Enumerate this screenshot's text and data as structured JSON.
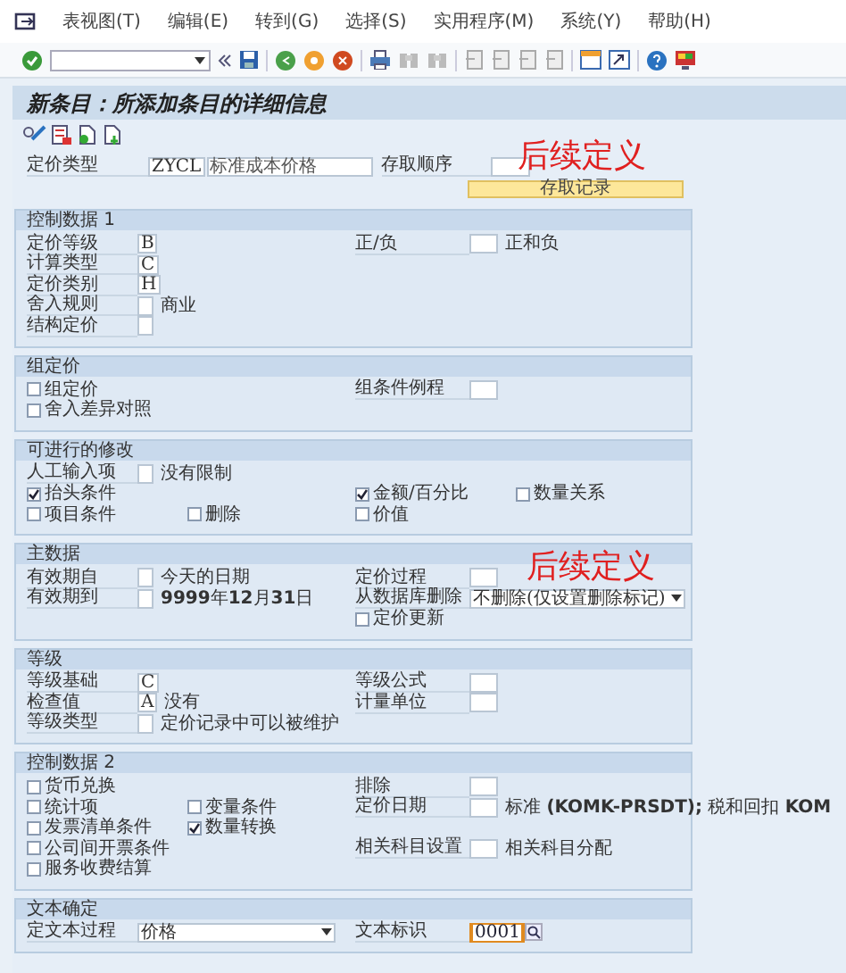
{
  "menu": [
    "表视图(T)",
    "编辑(E)",
    "转到(G)",
    "选择(S)",
    "实用程序(M)",
    "系统(Y)",
    "帮助(H)"
  ],
  "title": "新条目：所添加条目的详细信息",
  "header": {
    "pricing_type": {
      "label": "定价类型",
      "value": "ZYCL",
      "description": "标准成本价格"
    },
    "access_sequence": {
      "label": "存取顺序"
    },
    "annotation": "后续定义",
    "button": "存取记录"
  },
  "sections": [
    {
      "title": "控制数据 1",
      "rows": [
        {
          "left": [
            {
              "kind": "field",
              "label": "定价等级",
              "value": "B"
            }
          ],
          "right": [
            {
              "kind": "field",
              "label": "正/负",
              "text": "正和负"
            }
          ]
        },
        {
          "left": [
            {
              "kind": "field",
              "label": "计算类型",
              "value": "C"
            }
          ]
        },
        {
          "left": [
            {
              "kind": "field",
              "label": "定价类别",
              "value": "H"
            }
          ]
        },
        {
          "left": [
            {
              "kind": "field",
              "label": "舍入规则",
              "text": "商业"
            }
          ]
        },
        {
          "left": [
            {
              "kind": "field",
              "label": "结构定价"
            }
          ]
        }
      ]
    },
    {
      "title": "组定价",
      "rows": [
        {
          "left": [
            {
              "kind": "checkbox",
              "label": "组定价",
              "checked": false
            }
          ],
          "right": [
            {
              "kind": "field",
              "label": "组条件例程"
            }
          ]
        },
        {
          "left": [
            {
              "kind": "checkbox",
              "label": "舍入差异对照",
              "checked": false
            }
          ]
        }
      ]
    },
    {
      "title": "可进行的修改",
      "rows": [
        {
          "left": [
            {
              "kind": "field",
              "label": "人工输入项",
              "text": "没有限制"
            }
          ]
        },
        {
          "left": [
            {
              "kind": "checkbox",
              "label": "抬头条件",
              "checked": true
            }
          ],
          "right": [
            {
              "kind": "checkbox",
              "label": "金额/百分比",
              "checked": true
            },
            {
              "kind": "checkbox",
              "label": "数量关系",
              "checked": false
            }
          ]
        },
        {
          "left": [
            {
              "kind": "checkbox",
              "label": "项目条件",
              "checked": false
            },
            {
              "kind": "checkbox",
              "label": "删除",
              "checked": false
            }
          ],
          "right": [
            {
              "kind": "checkbox",
              "label": "价值",
              "checked": false
            }
          ]
        }
      ]
    },
    {
      "title": "主数据",
      "rows": [
        {
          "left": [
            {
              "kind": "field",
              "label": "有效期自",
              "text": "今天的日期"
            }
          ],
          "right": [
            {
              "kind": "field",
              "label": "定价过程",
              "annotation": "后续定义"
            }
          ]
        },
        {
          "left": [
            {
              "kind": "field",
              "label": "有效期到",
              "text": "**9999**年**12**月**31**日"
            }
          ],
          "right": [
            {
              "kind": "dropdown",
              "label": "从数据库删除",
              "value": "不删除(仅设置删除标记)"
            }
          ]
        },
        {
          "right": [
            {
              "kind": "checkbox",
              "label": "定价更新",
              "checked": false
            }
          ]
        }
      ]
    },
    {
      "title": "等级",
      "rows": [
        {
          "left": [
            {
              "kind": "field",
              "label": "等级基础",
              "value": "C"
            }
          ],
          "right": [
            {
              "kind": "field",
              "label": "等级公式"
            }
          ]
        },
        {
          "left": [
            {
              "kind": "field",
              "label": "检查值",
              "value": "A",
              "text": "没有"
            }
          ],
          "right": [
            {
              "kind": "field",
              "label": "计量单位"
            }
          ]
        },
        {
          "left": [
            {
              "kind": "field",
              "label": "等级类型",
              "text": "定价记录中可以被维护"
            }
          ]
        }
      ]
    },
    {
      "title": "控制数据 2",
      "rows": [
        {
          "left": [
            {
              "kind": "checkbox",
              "label": "货币兑换",
              "checked": false
            }
          ],
          "right": [
            {
              "kind": "field",
              "label": "排除"
            }
          ]
        },
        {
          "left": [
            {
              "kind": "checkbox",
              "label": "统计项",
              "checked": false
            },
            {
              "kind": "checkbox",
              "label": "变量条件",
              "checked": false
            }
          ],
          "right": [
            {
              "kind": "field",
              "label": "定价日期",
              "text": "标准 **(KOMK-PRSDT);** 税和回扣 **KOM**"
            }
          ]
        },
        {
          "left": [
            {
              "kind": "checkbox",
              "label": "发票清单条件",
              "checked": false
            },
            {
              "kind": "checkbox",
              "label": "数量转换",
              "checked": true
            }
          ]
        },
        {
          "left": [
            {
              "kind": "checkbox",
              "label": "公司间开票条件",
              "checked": false
            }
          ],
          "right": [
            {
              "kind": "field",
              "label": "相关科目设置",
              "text": "相关科目分配"
            }
          ]
        },
        {
          "left": [
            {
              "kind": "checkbox",
              "label": "服务收费结算",
              "checked": false
            }
          ]
        }
      ]
    },
    {
      "title": "文本确定",
      "rows": [
        {
          "left": [
            {
              "kind": "dropdown",
              "label": "定文本过程",
              "value": "价格"
            }
          ],
          "right": [
            {
              "kind": "lookup",
              "label": "文本标识",
              "value": "0001"
            }
          ]
        }
      ]
    }
  ]
}
